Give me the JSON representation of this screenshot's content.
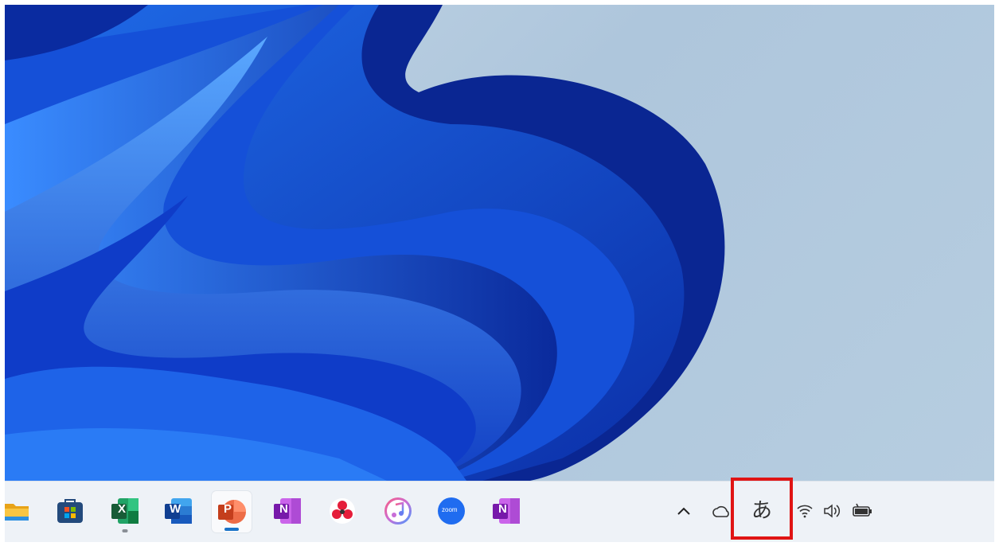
{
  "taskbar": {
    "apps": [
      {
        "name": "File Explorer",
        "icon": "folder-icon"
      },
      {
        "name": "Microsoft Store",
        "icon": "store-icon"
      },
      {
        "name": "Excel",
        "icon": "excel-icon",
        "letter": "X"
      },
      {
        "name": "Word",
        "icon": "word-icon",
        "letter": "W"
      },
      {
        "name": "PowerPoint",
        "icon": "powerpoint-icon",
        "letter": "P"
      },
      {
        "name": "OneNote",
        "icon": "onenote-icon",
        "letter": "N"
      },
      {
        "name": "Pinwheel app",
        "icon": "pinwheel-icon"
      },
      {
        "name": "iTunes",
        "icon": "itunes-icon"
      },
      {
        "name": "Zoom",
        "icon": "zoom-icon",
        "label": "zoom"
      },
      {
        "name": "OneNote",
        "icon": "onenote-icon",
        "letter": "N"
      }
    ],
    "tray": {
      "chevron": "^",
      "ime_mode": "あ",
      "icons": [
        "onedrive-icon",
        "wifi-icon",
        "volume-icon",
        "battery-icon"
      ]
    }
  },
  "colors": {
    "highlight_box": "#e01414",
    "accent": "#1a73c8",
    "excel": "#1f7a45",
    "word": "#2b5bb8",
    "powerpoint": "#d04a22",
    "onenote": "#7b2fb5",
    "zoom": "#1f6cf0"
  }
}
